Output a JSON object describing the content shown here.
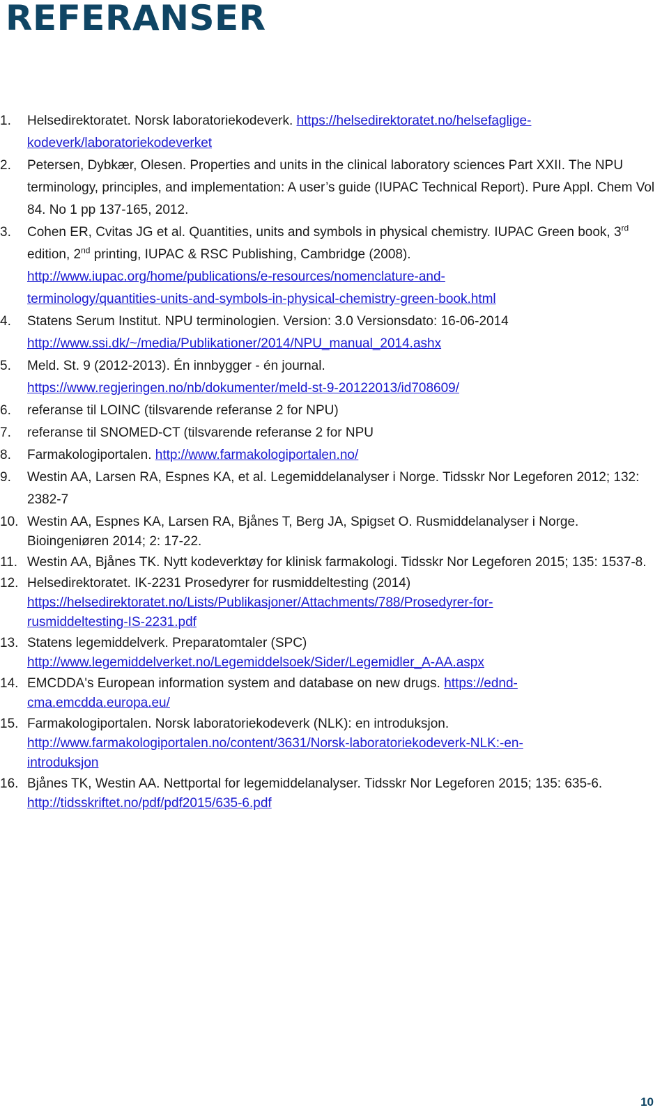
{
  "heading": "REFERANSER",
  "page_number": "10",
  "references": [
    {
      "num": "1.",
      "text": "Helsedirektoratet. Norsk laboratoriekodeverk. ",
      "link": "https://helsedirektoratet.no/helsefaglige-kodeverk/laboratoriekodeverket",
      "link_part1": "https://helsedirektoratet.no/helsefaglige-",
      "link_part2": "kodeverk/laboratoriekodeverket"
    },
    {
      "num": "2.",
      "text": "Petersen, Dybkær, Olesen. Properties and units in the clinical laboratory sciences Part XXII. The NPU terminology, principles, and implementation: A user’s guide (IUPAC Technical Report). Pure Appl. Chem Vol 84. No 1 pp 137-165, 2012."
    },
    {
      "num": "3.",
      "text_a": "Cohen ER, Cvitas JG et al. Quantities, units and symbols in physical chemistry. IUPAC Green book, 3",
      "sup1": "rd",
      "text_b": " edition, 2",
      "sup2": "nd",
      "text_c": " printing, IUPAC & RSC Publishing, Cambridge (2008).",
      "link_part1": "http://www.iupac.org/home/publications/e-resources/nomenclature-and-",
      "link_part2": "terminology/quantities-units-and-symbols-in-physical-chemistry-green-book.html"
    },
    {
      "num": "4.",
      "text": "Statens Serum Institut. NPU terminologien. Version: 3.0 Versionsdato: 16-06-2014",
      "link": "http://www.ssi.dk/~/media/Publikationer/2014/NPU_manual_2014.ashx"
    },
    {
      "num": "5.",
      "text": "Meld. St. 9 (2012-2013). Én innbygger - én journal.",
      "link": "https://www.regjeringen.no/nb/dokumenter/meld-st-9-20122013/id708609/"
    },
    {
      "num": "6.",
      "text": "referanse til LOINC (tilsvarende referanse 2 for NPU)"
    },
    {
      "num": "7.",
      "text": "referanse til SNOMED-CT (tilsvarende referanse 2 for NPU"
    },
    {
      "num": "8.",
      "text": "Farmakologiportalen. ",
      "link": "http://www.farmakologiportalen.no/"
    },
    {
      "num": "9.",
      "text": "Westin AA, Larsen RA, Espnes KA, et al. Legemiddelanalyser i Norge. Tidsskr Nor Legeforen 2012; 132: 2382-7"
    },
    {
      "num": "10.",
      "text": "Westin AA, Espnes KA, Larsen RA, Bjånes T, Berg JA, Spigset O. Rusmiddelanalyser i Norge. Bioingeniøren 2014; 2: 17-22."
    },
    {
      "num": "11.",
      "text": "Westin AA, Bjånes TK. Nytt kodeverktøy for klinisk farmakologi. Tidsskr Nor Legeforen 2015; 135: 1537-8."
    },
    {
      "num": "12.",
      "text": "Helsedirektoratet. IK-2231 Prosedyrer for rusmiddeltesting (2014)",
      "link_part1": "https://helsedirektoratet.no/Lists/Publikasjoner/Attachments/788/Prosedyrer-for-",
      "link_part2": "rusmiddeltesting-IS-2231.pdf"
    },
    {
      "num": "13.",
      "text": "Statens legemiddelverk. Preparatomtaler (SPC)",
      "link": "http://www.legemiddelverket.no/Legemiddelsoek/Sider/Legemidler_A-AA.aspx"
    },
    {
      "num": "14.",
      "text": "EMCDDA's European information system and database on new drugs. ",
      "link_part1": "https://ednd-",
      "link_part2": "cma.emcdda.europa.eu/"
    },
    {
      "num": "15.",
      "text": "Farmakologiportalen. Norsk laboratoriekodeverk (NLK): en introduksjon.",
      "link_part1": "http://www.farmakologiportalen.no/content/3631/Norsk-laboratoriekodeverk-NLK:-en-",
      "link_part2": "introduksjon"
    },
    {
      "num": "16.",
      "text": "Bjånes TK, Westin AA. Nettportal for legemiddelanalyser. Tidsskr Nor Legeforen 2015; 135: 635-6. ",
      "link": "http://tidsskriftet.no/pdf/pdf2015/635-6.pdf"
    }
  ]
}
